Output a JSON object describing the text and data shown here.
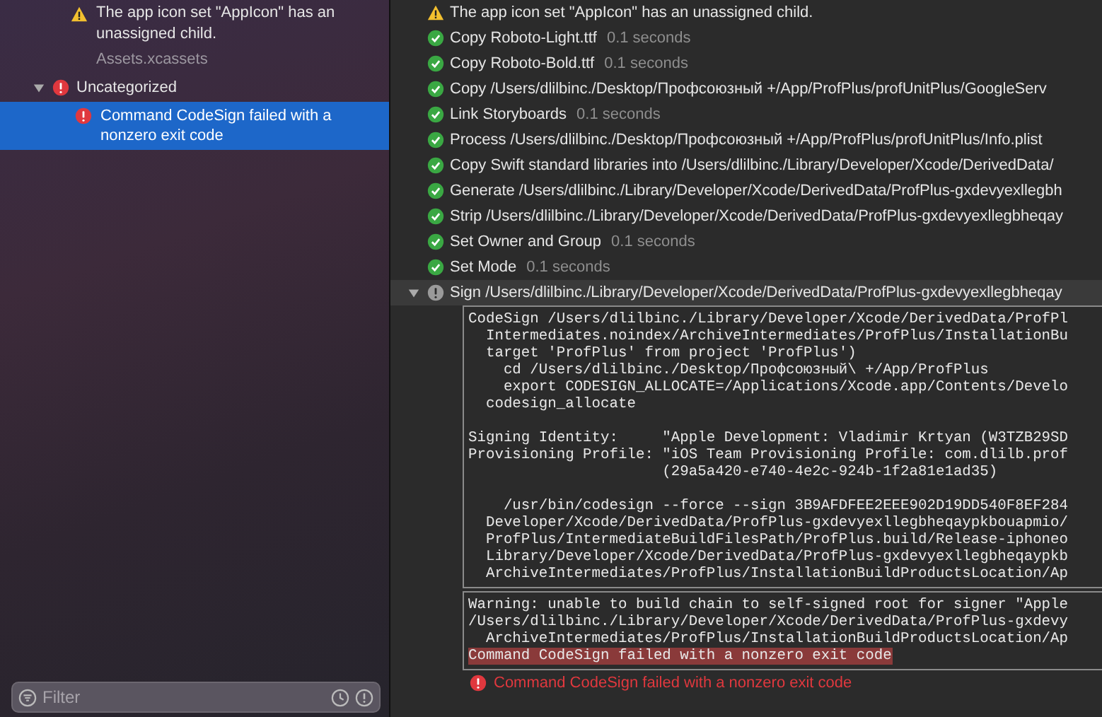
{
  "sidebar": {
    "items": [
      {
        "kind": "warning",
        "text": "The app icon set \"AppIcon\" has an unassigned child.",
        "subtitle": "Assets.xcassets"
      }
    ],
    "groups": [
      {
        "label": "Uncategorized",
        "kind": "error",
        "expanded": true,
        "children": [
          {
            "kind": "error",
            "text": "Command CodeSign failed with a nonzero exit code",
            "selected": true
          }
        ]
      }
    ],
    "filter": {
      "placeholder": "Filter"
    }
  },
  "log": {
    "steps": [
      {
        "kind": "warning",
        "label": "The app icon set \"AppIcon\" has an unassigned child.",
        "selected": false
      },
      {
        "kind": "success",
        "label": "Copy Roboto-Light.ttf",
        "duration": "0.1 seconds",
        "selected": false
      },
      {
        "kind": "success",
        "label": "Copy Roboto-Bold.ttf",
        "duration": "0.1 seconds",
        "selected": false
      },
      {
        "kind": "success",
        "label": "Copy /Users/dlilbinc./Desktop/Профсоюзный +/App/ProfPlus/profUnitPlus/GoogleServ",
        "selected": false
      },
      {
        "kind": "success",
        "label": "Link Storyboards",
        "duration": "0.1 seconds",
        "selected": false
      },
      {
        "kind": "success",
        "label": "Process /Users/dlilbinc./Desktop/Профсоюзный +/App/ProfPlus/profUnitPlus/Info.plist",
        "selected": false
      },
      {
        "kind": "success",
        "label": "Copy Swift standard libraries into /Users/dlilbinc./Library/Developer/Xcode/DerivedData/",
        "selected": false
      },
      {
        "kind": "success",
        "label": "Generate /Users/dlilbinc./Library/Developer/Xcode/DerivedData/ProfPlus-gxdevyexllegbh",
        "selected": false
      },
      {
        "kind": "success",
        "label": "Strip /Users/dlilbinc./Library/Developer/Xcode/DerivedData/ProfPlus-gxdevyexllegbheqay",
        "selected": false
      },
      {
        "kind": "success",
        "label": "Set Owner and Group",
        "duration": "0.1 seconds",
        "selected": false
      },
      {
        "kind": "success",
        "label": "Set Mode",
        "duration": "0.1 seconds",
        "selected": false
      },
      {
        "kind": "error",
        "label": "Sign /Users/dlilbinc./Library/Developer/Xcode/DerivedData/ProfPlus-gxdevyexllegbheqay",
        "expanded": true,
        "selected": true,
        "sections": [
          {
            "blocks": [
              [
                "CodeSign /Users/dlilbinc./Library/Developer/Xcode/DerivedData/ProfPl",
                "  Intermediates.noindex/ArchiveIntermediates/ProfPlus/InstallationBu",
                "  target 'ProfPlus' from project 'ProfPlus')",
                "    cd /Users/dlilbinc./Desktop/Профсоюзный\\ +/App/ProfPlus",
                "    export CODESIGN_ALLOCATE=/Applications/Xcode.app/Contents/Develo",
                "  codesign_allocate"
              ],
              [
                "Signing Identity:     \"Apple Development: Vladimir Krtyan (W3TZB29SD",
                "Provisioning Profile: \"iOS Team Provisioning Profile: com.dlilb.prof",
                "                      (29a5a420-e740-4e2c-924b-1f2a81e1ad35)"
              ],
              [
                "    /usr/bin/codesign --force --sign 3B9AFDFEE2EEE902D19DD540F8EF284",
                "  Developer/Xcode/DerivedData/ProfPlus-gxdevyexllegbheqaypkbouapmio/",
                "  ProfPlus/IntermediateBuildFilesPath/ProfPlus.build/Release-iphoneo",
                "  Library/Developer/Xcode/DerivedData/ProfPlus-gxdevyexllegbheqaypkb",
                "  ArchiveIntermediates/ProfPlus/InstallationBuildProductsLocation/Ap"
              ]
            ]
          },
          {
            "blocks": [
              [
                "Warning: unable to build chain to self-signed root for signer \"Apple",
                "/Users/dlilbinc./Library/Developer/Xcode/DerivedData/ProfPlus-gxdevy",
                "  ArchiveIntermediates/ProfPlus/InstallationBuildProductsLocation/Ap"
              ]
            ],
            "highlight": "Command CodeSign failed with a nonzero exit code"
          }
        ]
      }
    ],
    "error": "Command CodeSign failed with a nonzero exit code"
  }
}
